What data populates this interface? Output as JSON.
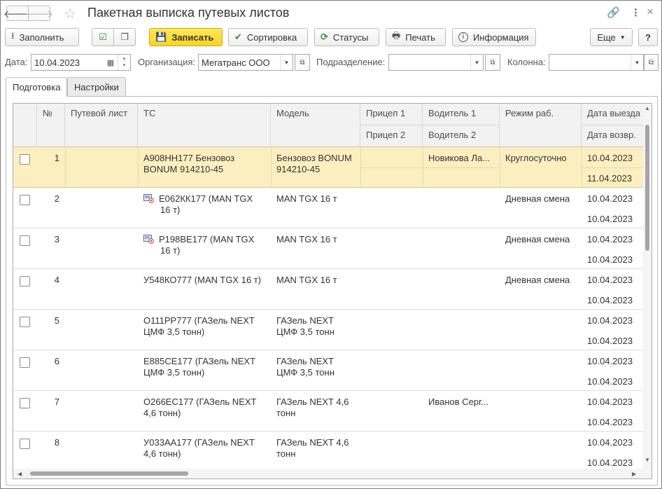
{
  "window": {
    "title": "Пакетная выписка путевых листов"
  },
  "toolbar": {
    "fill": "Заполнить",
    "save": "Записать",
    "sort": "Сортировка",
    "statuses": "Статусы",
    "print": "Печать",
    "info": "Информация",
    "more": "Еще",
    "help": "?"
  },
  "filters": {
    "date_label": "Дата:",
    "date_value": "10.04.2023",
    "org_label": "Организация:",
    "org_value": "Мегатранс ООО",
    "dept_label": "Подразделение:",
    "dept_value": "",
    "column_label": "Колонна:",
    "column_value": ""
  },
  "tabs": [
    "Подготовка",
    "Настройки"
  ],
  "table": {
    "headers": {
      "num": "№",
      "waybill": "Путевой лист",
      "vehicle": "ТС",
      "model": "Модель",
      "trailer1": "Прицеп 1",
      "trailer2": "Прицеп 2",
      "driver1": "Водитель 1",
      "driver2": "Водитель 2",
      "mode": "Режим раб.",
      "date_out": "Дата выезда",
      "date_back": "Дата возвр."
    },
    "rows": [
      {
        "num": "1",
        "vehicle": "А908НН177 Бензовоз BONUM 914210-45",
        "icon": false,
        "model": "Бензовоз BONUM 914210-45",
        "driver1": "Новикова Ла...",
        "mode": "Круглосуточно",
        "date_out": "10.04.2023",
        "date_back": "11.04.2023",
        "selected": true
      },
      {
        "num": "2",
        "vehicle": "Е062КК177 (MAN TGX 16 т)",
        "icon": true,
        "model": "MAN TGX 16 т",
        "driver1": "",
        "mode": "Дневная смена",
        "date_out": "10.04.2023",
        "date_back": "10.04.2023",
        "selected": false
      },
      {
        "num": "3",
        "vehicle": "Р198ВЕ177 (MAN TGX 16 т)",
        "icon": true,
        "model": "MAN TGX 16 т",
        "driver1": "",
        "mode": "Дневная смена",
        "date_out": "10.04.2023",
        "date_back": "10.04.2023",
        "selected": false
      },
      {
        "num": "4",
        "vehicle": "У548КО777 (MAN TGX  16 т)",
        "icon": false,
        "model": "MAN TGX 16 т",
        "driver1": "",
        "mode": "Дневная смена",
        "date_out": "10.04.2023",
        "date_back": "10.04.2023",
        "selected": false
      },
      {
        "num": "5",
        "vehicle": "О111РР777 (ГАЗель NEXT ЦМФ 3,5 тонн)",
        "icon": false,
        "model": "ГАЗель NEXT ЦМФ 3,5 тонн",
        "driver1": "",
        "mode": "",
        "date_out": "10.04.2023",
        "date_back": "10.04.2023",
        "selected": false
      },
      {
        "num": "6",
        "vehicle": "Е885СЕ177 (ГАЗель NEXT ЦМФ 3,5 тонн)",
        "icon": false,
        "model": "ГАЗель NEXT ЦМФ 3,5 тонн",
        "driver1": "",
        "mode": "",
        "date_out": "10.04.2023",
        "date_back": "10.04.2023",
        "selected": false
      },
      {
        "num": "7",
        "vehicle": "О266ЕС177 (ГАЗель NEXT 4,6 тонн)",
        "icon": false,
        "model": "ГАЗель NEXT 4,6 тонн",
        "driver1": "Иванов Серг...",
        "mode": "",
        "date_out": "10.04.2023",
        "date_back": "10.04.2023",
        "selected": false
      },
      {
        "num": "8",
        "vehicle": "У033АА177 (ГАЗель NEXT 4,6 тонн)",
        "icon": false,
        "model": "ГАЗель NEXT 4,6 тонн",
        "driver1": "",
        "mode": "",
        "date_out": "10.04.2023",
        "date_back": "10.04.2023",
        "selected": false
      }
    ]
  },
  "colors": {
    "accent": "#f9d523",
    "selected_row": "#fbefc0",
    "header_bg": "#f2f2f2"
  }
}
